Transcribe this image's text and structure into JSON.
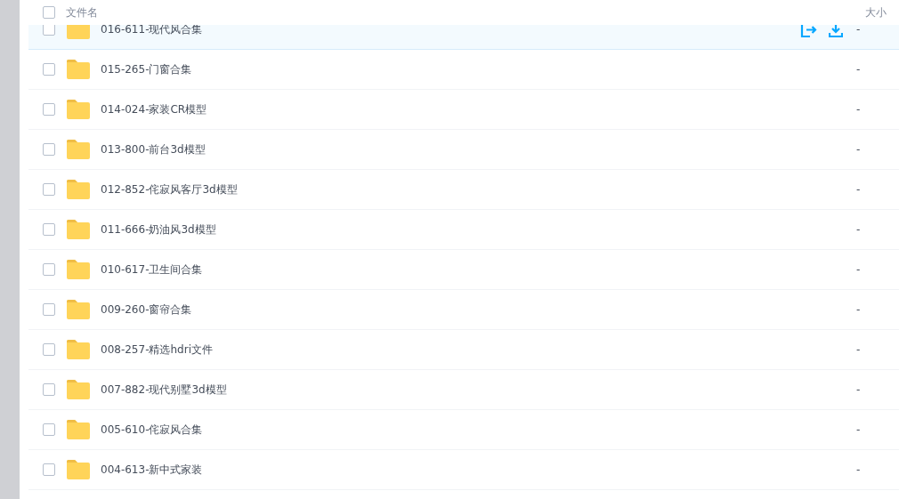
{
  "header": {
    "checked": false,
    "name_label": "文件名",
    "size_label": "大小"
  },
  "rows": [
    {
      "name": "016-611-现代风合集",
      "size": "-",
      "checked": false,
      "hovered": true
    },
    {
      "name": "015-265-门窗合集",
      "size": "-",
      "checked": false,
      "hovered": false
    },
    {
      "name": "014-024-家装CR模型",
      "size": "-",
      "checked": false,
      "hovered": false
    },
    {
      "name": "013-800-前台3d模型",
      "size": "-",
      "checked": false,
      "hovered": false
    },
    {
      "name": "012-852-侘寂风客厅3d模型",
      "size": "-",
      "checked": false,
      "hovered": false
    },
    {
      "name": "011-666-奶油风3d模型",
      "size": "-",
      "checked": false,
      "hovered": false
    },
    {
      "name": "010-617-卫生间合集",
      "size": "-",
      "checked": false,
      "hovered": false
    },
    {
      "name": "009-260-窗帘合集",
      "size": "-",
      "checked": false,
      "hovered": false
    },
    {
      "name": "008-257-精选hdri文件",
      "size": "-",
      "checked": false,
      "hovered": false
    },
    {
      "name": "007-882-现代别墅3d模型",
      "size": "-",
      "checked": false,
      "hovered": false
    },
    {
      "name": "005-610-侘寂风合集",
      "size": "-",
      "checked": false,
      "hovered": false
    },
    {
      "name": "004-613-新中式家装",
      "size": "-",
      "checked": false,
      "hovered": false
    }
  ]
}
